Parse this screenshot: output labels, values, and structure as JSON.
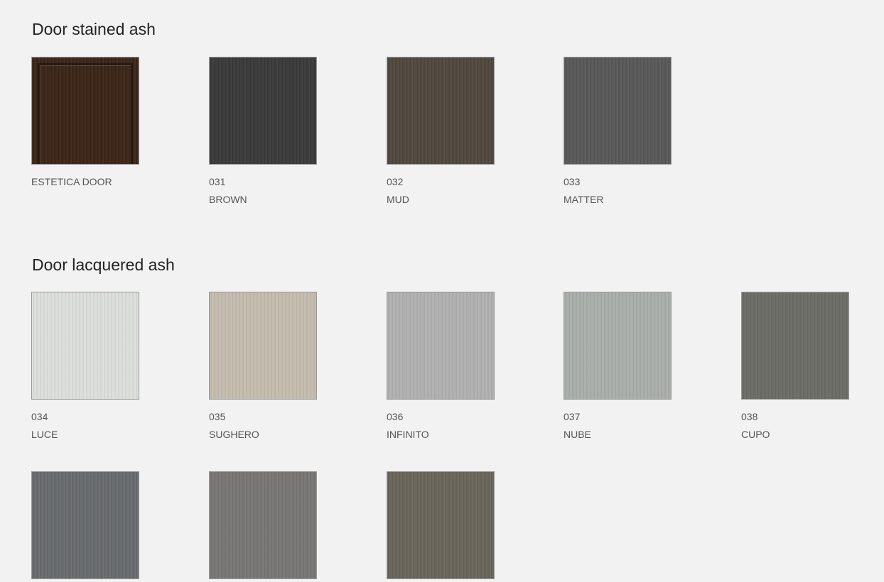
{
  "sections": [
    {
      "title": "Door stained ash",
      "items": [
        {
          "code": "",
          "name": "ESTETICA DOOR",
          "color": "#3b2518",
          "icon": "door-icon"
        },
        {
          "code": "031",
          "name": "BROWN",
          "color": "#3a3a3a"
        },
        {
          "code": "032",
          "name": "MUD",
          "color": "#50483e"
        },
        {
          "code": "033",
          "name": "MATTER",
          "color": "#585858"
        }
      ]
    },
    {
      "title": "Door lacquered ash",
      "items": [
        {
          "code": "034",
          "name": "LUCE",
          "color": "#dcdedb"
        },
        {
          "code": "035",
          "name": "SUGHERO",
          "color": "#c3bcae"
        },
        {
          "code": "036",
          "name": "INFINITO",
          "color": "#b0b0b1"
        },
        {
          "code": "037",
          "name": "NUBE",
          "color": "#a9aeab"
        },
        {
          "code": "038",
          "name": "CUPO",
          "color": "#6c6c66"
        },
        {
          "code": "",
          "name": "",
          "color": "#686b6d"
        },
        {
          "code": "",
          "name": "",
          "color": "#787674"
        },
        {
          "code": "",
          "name": "",
          "color": "#69655a"
        }
      ]
    }
  ]
}
